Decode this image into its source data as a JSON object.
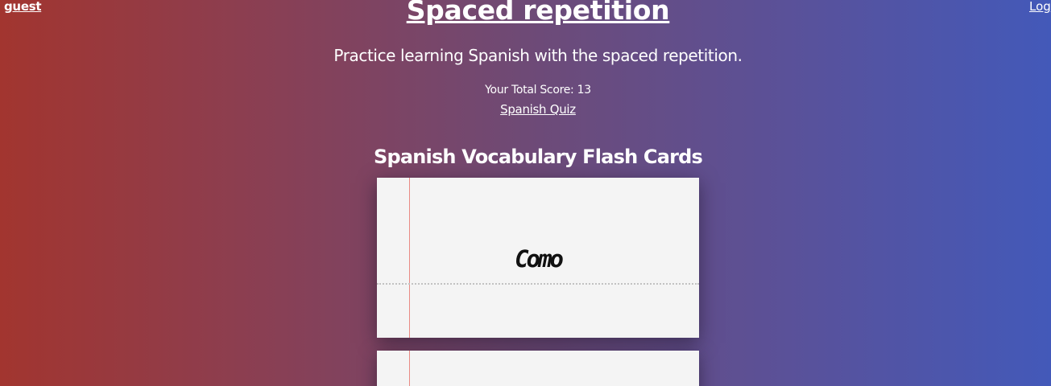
{
  "header": {
    "user_link": "guest",
    "login_link": "Log"
  },
  "main": {
    "title": "Spaced repetition",
    "subtitle": "Practice learning Spanish with the spaced repetition.",
    "score_text": "Your Total Score: 13",
    "quiz_link": "Spanish Quiz",
    "section_heading": "Spanish Vocabulary Flash Cards"
  },
  "flashcards": [
    {
      "word": "Como"
    },
    {
      "word": ""
    }
  ],
  "colors": {
    "gradient_left": "#a2352f",
    "gradient_right": "#4359b9",
    "card_background": "#f4f4f4",
    "card_margin_line": "#e98a84"
  }
}
